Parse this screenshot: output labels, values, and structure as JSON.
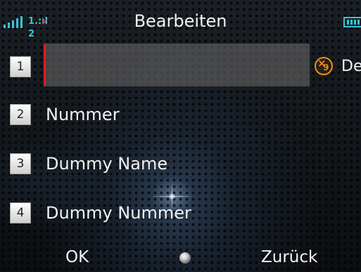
{
  "status_bar": {
    "title": "Bearbeiten",
    "signal_text": "1.:ıl 2",
    "network_error_text": "×",
    "colors": {
      "signal": "#35c4d6",
      "error": "#e03030"
    }
  },
  "fields": {
    "input_value": "",
    "t9_mode": "De",
    "t9_icon": "t9-input-mode-icon"
  },
  "list": [
    {
      "number": "1",
      "label": ""
    },
    {
      "number": "2",
      "label": "Nummer"
    },
    {
      "number": "3",
      "label": "Dummy Name"
    },
    {
      "number": "4",
      "label": "Dummy Nummer"
    }
  ],
  "softkeys": {
    "left": "OK",
    "center_icon": "center-select-dot",
    "right": "Zurück"
  },
  "colors": {
    "cursor": "#e11c1c",
    "t9_accent": "#f08c1a"
  }
}
